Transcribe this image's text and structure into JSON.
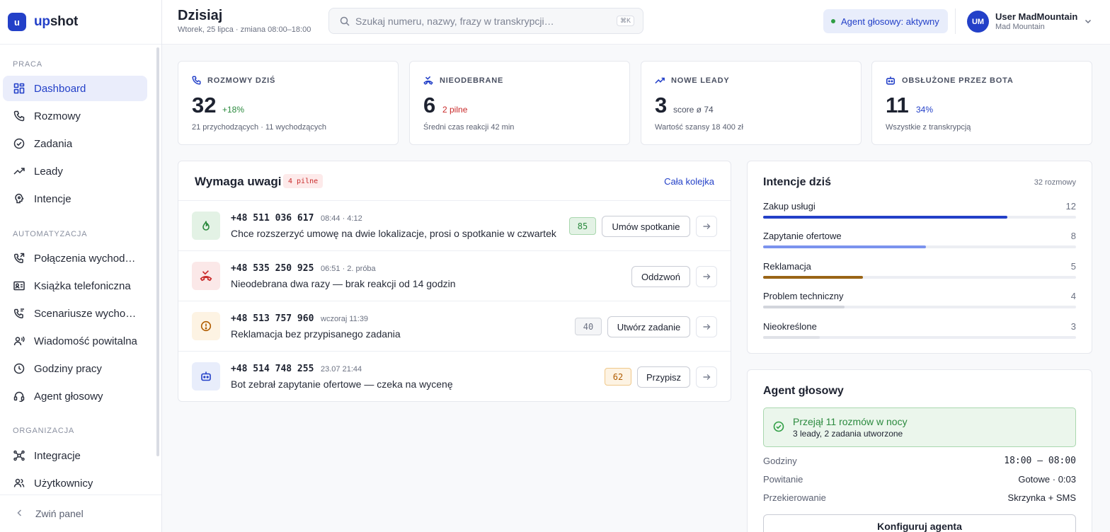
{
  "brand": {
    "logo_letter": "u",
    "name_part1": "up",
    "name_part2": "shot"
  },
  "sidebar": {
    "sections": [
      {
        "label": "PRACA"
      },
      {
        "label": "AUTOMATYZACJA"
      },
      {
        "label": "ORGANIZACJA"
      }
    ],
    "items": [
      {
        "label": "Dashboard",
        "icon": "dashboard-icon",
        "active": true
      },
      {
        "label": "Rozmowy",
        "icon": "phone-icon"
      },
      {
        "label": "Zadania",
        "icon": "check-circle-icon"
      },
      {
        "label": "Leady",
        "icon": "trending-up-icon"
      },
      {
        "label": "Intencje",
        "icon": "intent-icon"
      },
      {
        "label": "Połączenia wychodzące",
        "icon": "phone-outgoing-icon"
      },
      {
        "label": "Książka telefoniczna",
        "icon": "contact-card-icon"
      },
      {
        "label": "Scenariusze wychodzące",
        "icon": "phone-script-icon"
      },
      {
        "label": "Wiadomość powitalna",
        "icon": "speaker-user-icon"
      },
      {
        "label": "Godziny pracy",
        "icon": "clock-icon"
      },
      {
        "label": "Agent głosowy",
        "icon": "headset-icon"
      },
      {
        "label": "Integracje",
        "icon": "integrations-icon"
      },
      {
        "label": "Użytkownicy",
        "icon": "users-icon"
      }
    ],
    "collapse_label": "Zwiń panel"
  },
  "header": {
    "title": "Dzisiaj",
    "subtitle": "Wtorek, 25 lipca · zmiana 08:00–18:00",
    "search_placeholder": "Szukaj numeru, nazwy, frazy w transkrypcji…",
    "search_shortcut": "⌘K",
    "agent_status": "Agent głosowy: aktywny",
    "user": {
      "initials": "UM",
      "name": "User MadMountain",
      "org": "Mad Mountain"
    }
  },
  "stats": [
    {
      "label": "ROZMOWY DZIŚ",
      "value": "32",
      "extra": "+18%",
      "extra_color": "#2b8a3e",
      "foot": "21 przychodzących · 11 wychodzących"
    },
    {
      "label": "NIEODEBRANE",
      "value": "6",
      "extra": "2 pilne",
      "extra_color": "#c92a2a",
      "foot": "Średni czas reakcji 42 min"
    },
    {
      "label": "NOWE LEADY",
      "value": "3",
      "extra": "score ø 74",
      "extra_color": "#4a5062",
      "foot": "Wartość szansy 18 400 zł"
    },
    {
      "label": "OBSŁUŻONE PRZEZ BOTA",
      "value": "11",
      "extra": "34%",
      "extra_color": "#2340c8",
      "foot": "Wszystkie z transkrypcją"
    }
  ],
  "attention": {
    "title": "Wymaga uwagi",
    "badge": "4 pilne",
    "link": "Cała kolejka",
    "rows": [
      {
        "phone": "+48 511 036 617",
        "meta": "08:44 · 4:12",
        "desc": "Chce rozszerzyć umowę na dwie lokalizacje, prosi o spotkanie w czwartek",
        "score": "85",
        "action": "Umów spotkanie",
        "icon": "flame-icon"
      },
      {
        "phone": "+48 535 250 925",
        "meta": "06:51 · 2. próba",
        "desc": "Nieodebrana dwa razy — brak reakcji od 14 godzin",
        "score": "",
        "action": "Oddzwoń",
        "icon": "missed-call-icon"
      },
      {
        "phone": "+48 513 757 960",
        "meta": "wczoraj 11:39",
        "desc": "Reklamacja bez przypisanego zadania",
        "score": "40",
        "action": "Utwórz zadanie",
        "icon": "alert-circle-icon"
      },
      {
        "phone": "+48 514 748 255",
        "meta": "23.07 21:44",
        "desc": "Bot zebrał zapytanie ofertowe — czeka na wycenę",
        "score": "62",
        "action": "Przypisz",
        "icon": "bot-icon"
      }
    ]
  },
  "intents": {
    "title": "Intencje dziś",
    "count": "32 rozmowy",
    "items": [
      {
        "name": "Zakup usługi",
        "value": 12,
        "color": "#2340c8",
        "fraction": 0.78
      },
      {
        "name": "Zapytanie ofertowe",
        "value": 8,
        "color": "#7b93ee",
        "fraction": 0.52
      },
      {
        "name": "Reklamacja",
        "value": 5,
        "color": "#9a6516",
        "fraction": 0.32
      },
      {
        "name": "Problem techniczny",
        "value": 4,
        "color": "#d2d5dc",
        "fraction": 0.26
      },
      {
        "name": "Nieokreślone",
        "value": 3,
        "color": "#e0e2e8",
        "fraction": 0.18
      }
    ]
  },
  "agent": {
    "title": "Agent głosowy",
    "note_title": "Przejął 11 rozmów w nocy",
    "note_sub": "3 leady, 2 zadania utworzone",
    "details": [
      {
        "key": "Godziny",
        "value": "18:00 – 08:00"
      },
      {
        "key": "Powitanie",
        "value": "Gotowe · 0:03"
      },
      {
        "key": "Przekierowanie",
        "value": "Skrzynka + SMS"
      }
    ],
    "button": "Konfiguruj agenta"
  }
}
